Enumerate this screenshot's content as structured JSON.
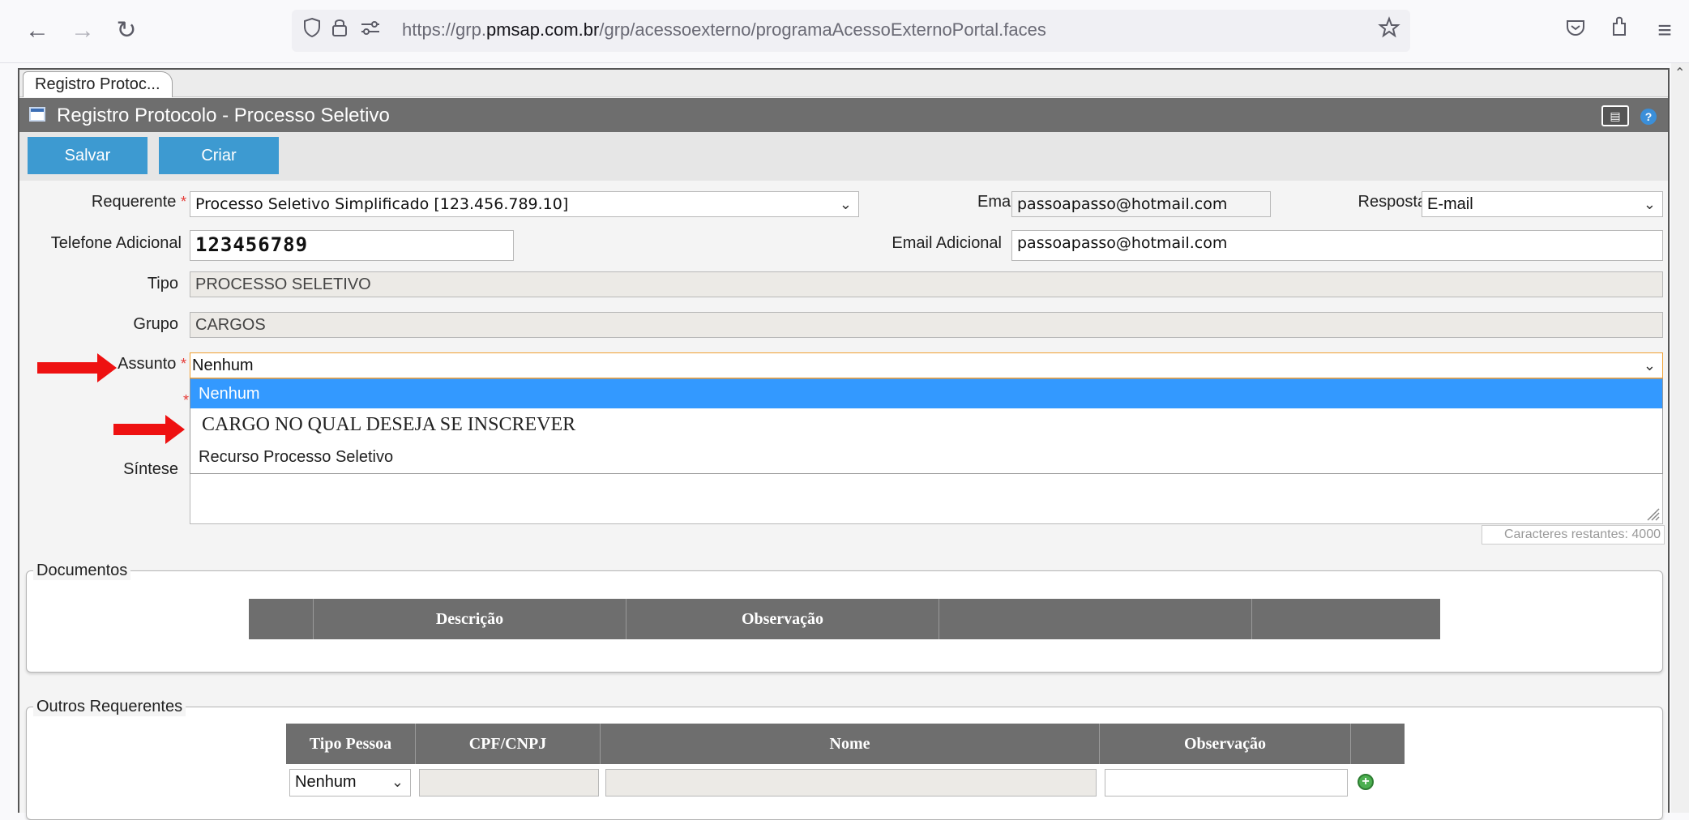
{
  "browser": {
    "url_prefix": "https://grp.",
    "url_domain": "pmsap.com.br",
    "url_path": "/grp/acessoexterno/programaAcessoExternoPortal.faces"
  },
  "page": {
    "tab_label": "Registro Protoc...",
    "title": "Registro Protocolo - Processo Seletivo"
  },
  "toolbar": {
    "save_label": "Salvar",
    "create_label": "Criar"
  },
  "form": {
    "requerente_label": "Requerente",
    "requerente_value": "Processo Seletivo Simplificado [123.456.789.10]",
    "email_label": "Email",
    "email_value": "passoapasso@hotmail.com",
    "resposta_label": "Resposta",
    "resposta_value": "E-mail",
    "telefone_label": "Telefone Adicional",
    "telefone_value": "123456789",
    "email_adicional_label": "Email Adicional",
    "email_adicional_value": "passoapasso@hotmail.com",
    "tipo_label": "Tipo",
    "tipo_value": "PROCESSO SELETIVO",
    "grupo_label": "Grupo",
    "grupo_value": "CARGOS",
    "assunto_label": "Assunto",
    "assunto_value": "Nenhum",
    "assunto_options": [
      "Nenhum",
      "CARGO NO QUAL DESEJA SE INSCREVER",
      "Recurso Processo Seletivo"
    ],
    "sintese_label": "Síntese",
    "chars_remaining": "Caracteres restantes: 4000",
    "required_mark": "*"
  },
  "documentos": {
    "legend": "Documentos",
    "columns": [
      "",
      "Descrição",
      "Observação",
      "",
      ""
    ]
  },
  "outros": {
    "legend": "Outros Requerentes",
    "columns": [
      "Tipo Pessoa",
      "CPF/CNPJ",
      "Nome",
      "Observação",
      ""
    ],
    "tipo_pessoa_value": "Nenhum"
  }
}
